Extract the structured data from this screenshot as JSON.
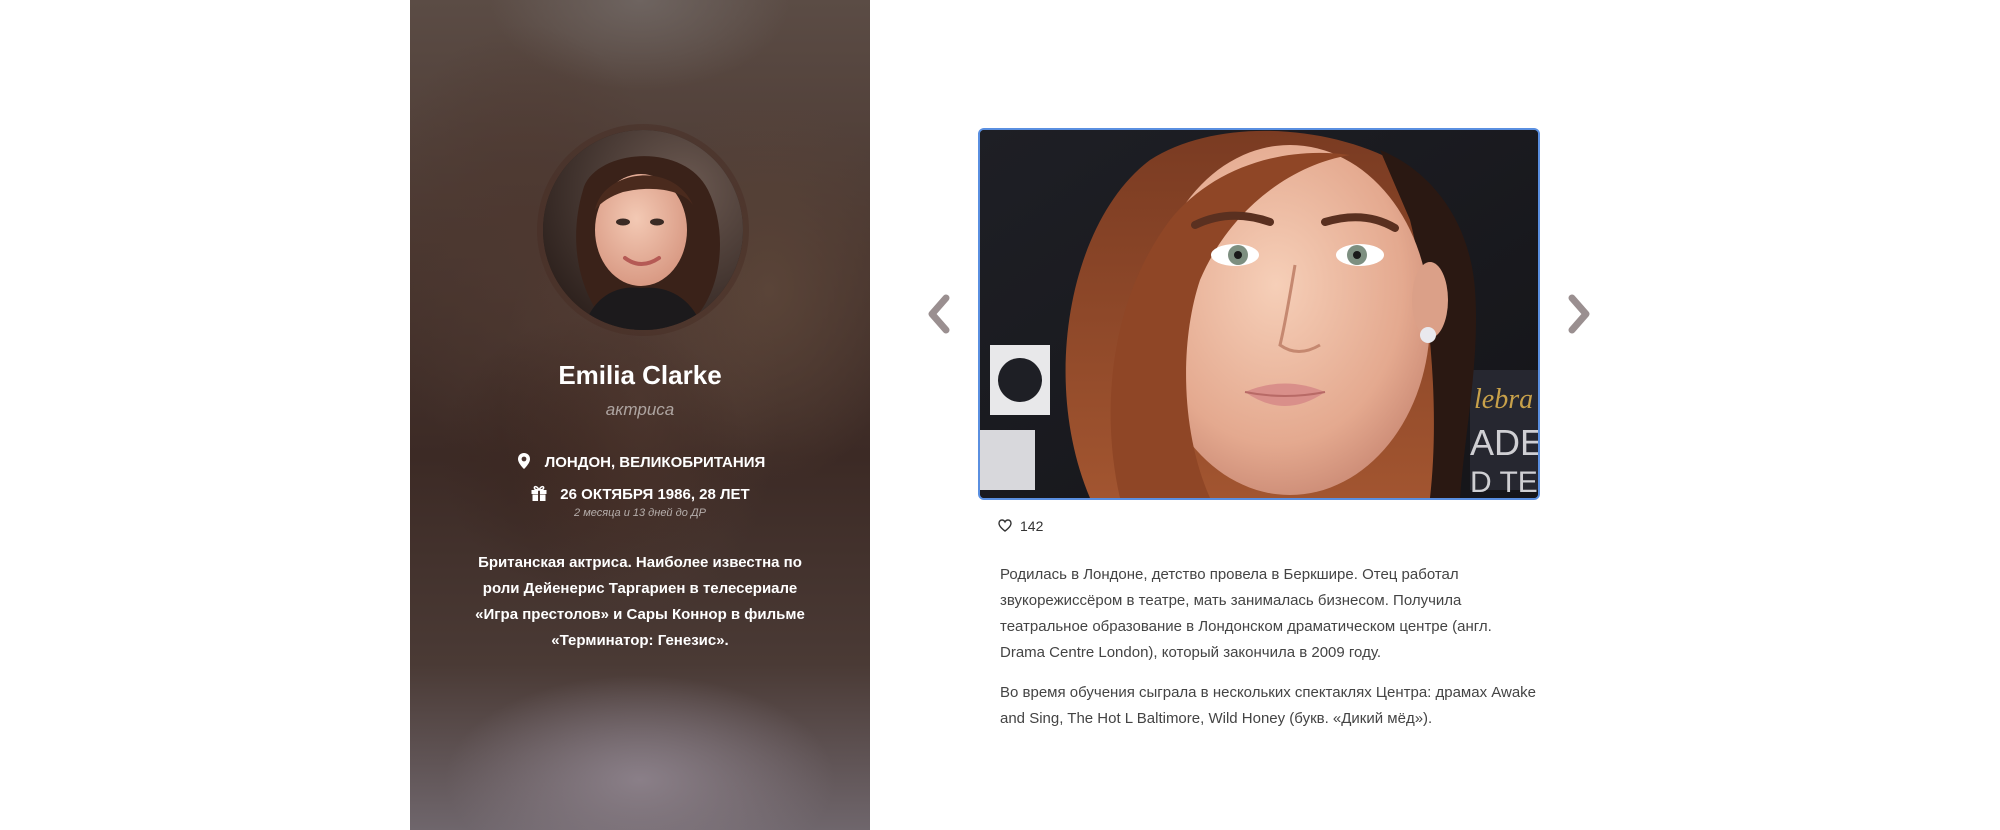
{
  "profile": {
    "name": "Emilia Clarke",
    "occupation": "актриса",
    "location": "ЛОНДОН, ВЕЛИКОБРИТАНИЯ",
    "birthday": "26 ОКТЯБРЯ 1986, 28 ЛЕТ",
    "birthday_note": "2 месяца и 13 дней до ДР",
    "bio_short": "Британская актриса. Наиболее известна по роли Дейенерис Таргариен в телесериале «Игра престолов» и Сары Коннор в фильме «Терминатор: Генезис».",
    "icons": {
      "location": "map-pin-icon",
      "birthday": "gift-icon"
    }
  },
  "gallery": {
    "prev_icon": "chevron-left-icon",
    "next_icon": "chevron-right-icon",
    "likes_icon": "heart-icon",
    "likes_count": "142"
  },
  "bio": {
    "paragraph_1": "Родилась в Лондоне, детство провела в Беркшире. Отец работал звукорежиссёром в театре, мать занималась бизнесом. Получила театральное образование в Лондонском драматическом центре (англ. Drama Centre London), который закончила в 2009 году.",
    "paragraph_2": "Во время обучения сыграла в нескольких спектаклях Центра: драмах Awake and Sing, The Hot L Baltimore, Wild Honey (букв. «Дикий мёд»)."
  },
  "colors": {
    "photo_border": "#5a8fe0",
    "arrow": "#9a8f90",
    "text": "#444444"
  }
}
